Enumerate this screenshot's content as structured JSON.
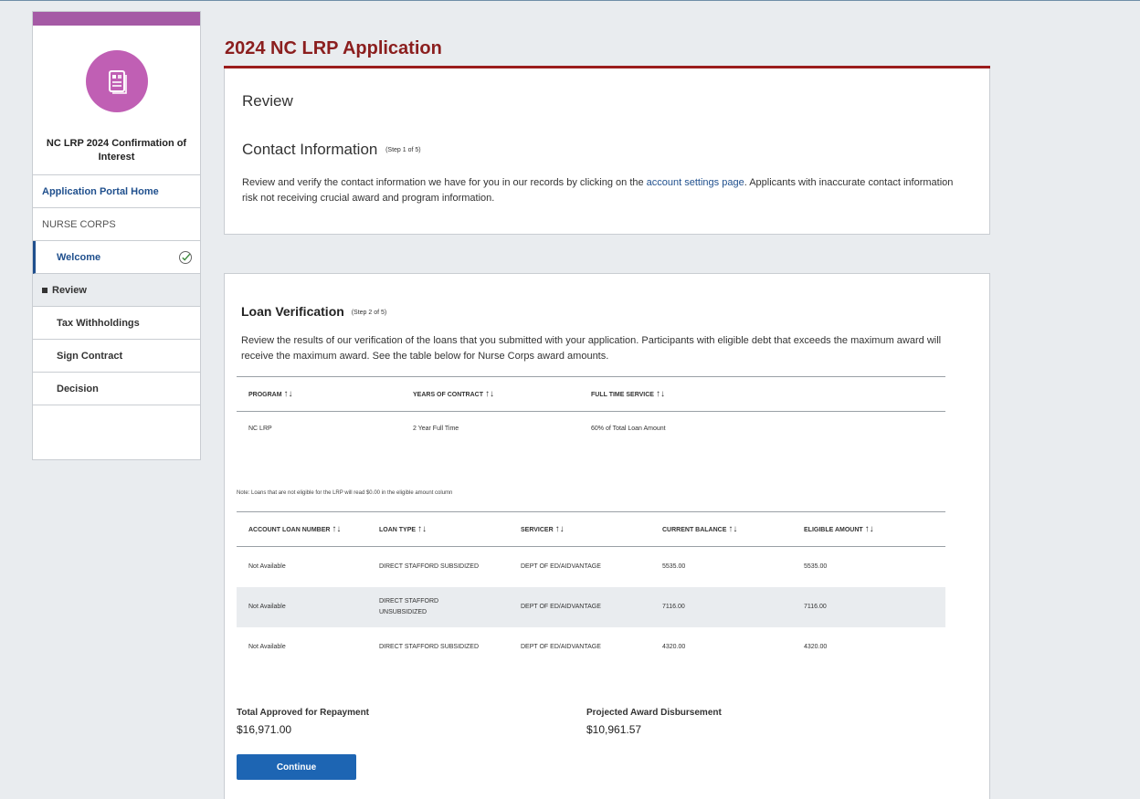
{
  "sidebar": {
    "title": "NC LRP 2024 Confirmation of Interest",
    "portal_link": "Application Portal Home",
    "section": "NURSE CORPS",
    "items": [
      {
        "label": "Welcome",
        "completed": true
      },
      {
        "label": "Review",
        "active": true
      },
      {
        "label": "Tax Withholdings"
      },
      {
        "label": "Sign Contract"
      },
      {
        "label": "Decision"
      }
    ]
  },
  "page": {
    "title": "2024 NC LRP Application"
  },
  "review": {
    "heading": "Review",
    "contact_heading": "Contact Information",
    "contact_step": "(Step 1 of 5)",
    "contact_text_before": "Review and verify the contact information we have for you in our records by clicking on the ",
    "contact_link": "account settings page",
    "contact_text_after": ". Applicants with inaccurate contact information risk not receiving crucial award and program information."
  },
  "loan": {
    "heading": "Loan Verification",
    "step": "(Step 2 of 5)",
    "description": "Review the results of our verification of the loans that you submitted with your application. Participants with eligible debt that exceeds the maximum award will receive the maximum award. See the table below for Nurse Corps award amounts.",
    "program_table": {
      "headers": [
        "PROGRAM",
        "YEARS OF CONTRACT",
        "FULL TIME SERVICE"
      ],
      "row": [
        "NC LRP",
        "2 Year Full Time",
        "60% of Total Loan Amount"
      ]
    },
    "note": "Note: Loans that are not eligible for the LRP will read $0.00 in the eligible amount column",
    "loan_table": {
      "headers": [
        "ACCOUNT LOAN NUMBER",
        "LOAN TYPE",
        "SERVICER",
        "CURRENT BALANCE",
        "ELIGIBLE AMOUNT"
      ],
      "rows": [
        [
          "Not Available",
          "DIRECT STAFFORD SUBSIDIZED",
          "DEPT OF ED/AIDVANTAGE",
          "5535.00",
          "5535.00"
        ],
        [
          "Not Available",
          "DIRECT STAFFORD UNSUBSIDIZED",
          "DEPT OF ED/AIDVANTAGE",
          "7116.00",
          "7116.00"
        ],
        [
          "Not Available",
          "DIRECT STAFFORD SUBSIDIZED",
          "DEPT OF ED/AIDVANTAGE",
          "4320.00",
          "4320.00"
        ]
      ]
    },
    "total_label": "Total Approved for Repayment",
    "total_value": "$16,971.00",
    "projected_label": "Projected Award Disbursement",
    "projected_value": "$10,961.57",
    "continue_label": "Continue"
  },
  "sort_icon": "↑↓",
  "colors": {
    "accent": "#9b1c1c",
    "avatar": "#c05fb4",
    "sidebar_bar": "#a55aa5",
    "button": "#1d65b3",
    "link": "#1f4f8d",
    "check": "#3c8a3c"
  }
}
